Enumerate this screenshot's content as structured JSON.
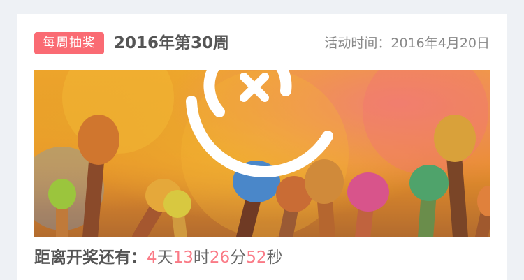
{
  "card": {
    "badge": "每周抽奖",
    "week_title": "2016年第30周",
    "activity_label": "活动时间：",
    "activity_date": "2016年4月20日"
  },
  "banner": {
    "logo_icon": "lottery-x-logo-icon",
    "image": "colorful-powder-raised-hands"
  },
  "countdown": {
    "label": "距离开奖还有：",
    "days": "4",
    "days_unit": "天",
    "hours": "13",
    "hours_unit": "时",
    "minutes": "26",
    "minutes_unit": "分",
    "seconds": "52",
    "seconds_unit": "秒"
  },
  "colors": {
    "accent": "#fa6b73",
    "number": "#fa7a86",
    "background": "#eef1f5"
  }
}
